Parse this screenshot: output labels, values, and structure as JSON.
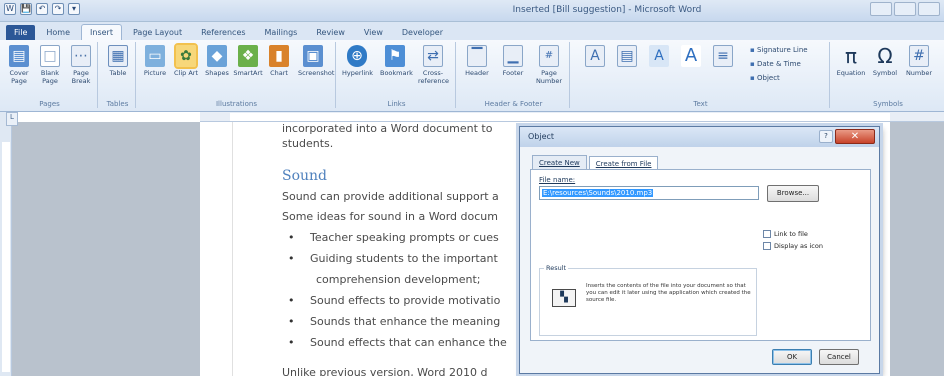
{
  "window": {
    "title": "Inserted [Bill suggestion] - Microsoft Word",
    "qat": [
      "W",
      "💾",
      "↶",
      "↷",
      "▾"
    ]
  },
  "tabs": [
    {
      "label": "File",
      "kind": "file"
    },
    {
      "label": "Home",
      "kind": ""
    },
    {
      "label": "Insert",
      "kind": "active"
    },
    {
      "label": "Page Layout",
      "kind": ""
    },
    {
      "label": "References",
      "kind": ""
    },
    {
      "label": "Mailings",
      "kind": ""
    },
    {
      "label": "Review",
      "kind": ""
    },
    {
      "label": "View",
      "kind": ""
    },
    {
      "label": "Developer",
      "kind": ""
    }
  ],
  "ribbon": {
    "groups": {
      "pages": "Pages",
      "tables": "Tables",
      "illustrations": "Illustrations",
      "links": "Links",
      "header_footer": "Header & Footer",
      "text": "Text",
      "symbols": "Symbols"
    },
    "buttons": {
      "cover_page": "Cover Page",
      "blank_page": "Blank Page",
      "page_break": "Page Break",
      "table": "Table",
      "picture": "Picture",
      "clip_art": "Clip Art",
      "shapes": "Shapes",
      "smartart": "SmartArt",
      "chart": "Chart",
      "screenshot": "Screenshot",
      "hyperlink": "Hyperlink",
      "bookmark": "Bookmark",
      "cross_reference": "Cross-reference",
      "header": "Header",
      "footer": "Footer",
      "page_number": "Page Number",
      "equation": "Equation",
      "symbol": "Symbol",
      "number": "Number"
    },
    "small": {
      "signature_line": "Signature Line",
      "date_time": "Date & Time",
      "object": "Object"
    }
  },
  "document": {
    "line1": "incorporated into a Word document to",
    "line2": "students.",
    "heading": "Sound",
    "p1": "Sound can provide additional support a",
    "p2": "Some ideas for sound in a Word docum",
    "bullets": [
      "Teacher speaking prompts or cues",
      "Guiding students to the important",
      "comprehension development;",
      "Sound effects to provide motivatio",
      "Sounds that enhance the meaning",
      "Sound effects that can enhance the"
    ],
    "last": "Unlike previous version, Word 2010 d"
  },
  "dialog": {
    "title": "Object",
    "close": "✕",
    "help": "?",
    "tab_new": "Create New",
    "tab_file": "Create from File",
    "file_label": "File name:",
    "file_value": "E:\\resources\\Sounds\\2010.mp3",
    "browse": "Browse...",
    "link_to_file": "Link to file",
    "display_as_icon": "Display as icon",
    "result_label": "Result",
    "result_text": "Inserts the contents of the file into your document so that you can edit it later using the application which created the source file.",
    "ok": "OK",
    "cancel": "Cancel"
  }
}
